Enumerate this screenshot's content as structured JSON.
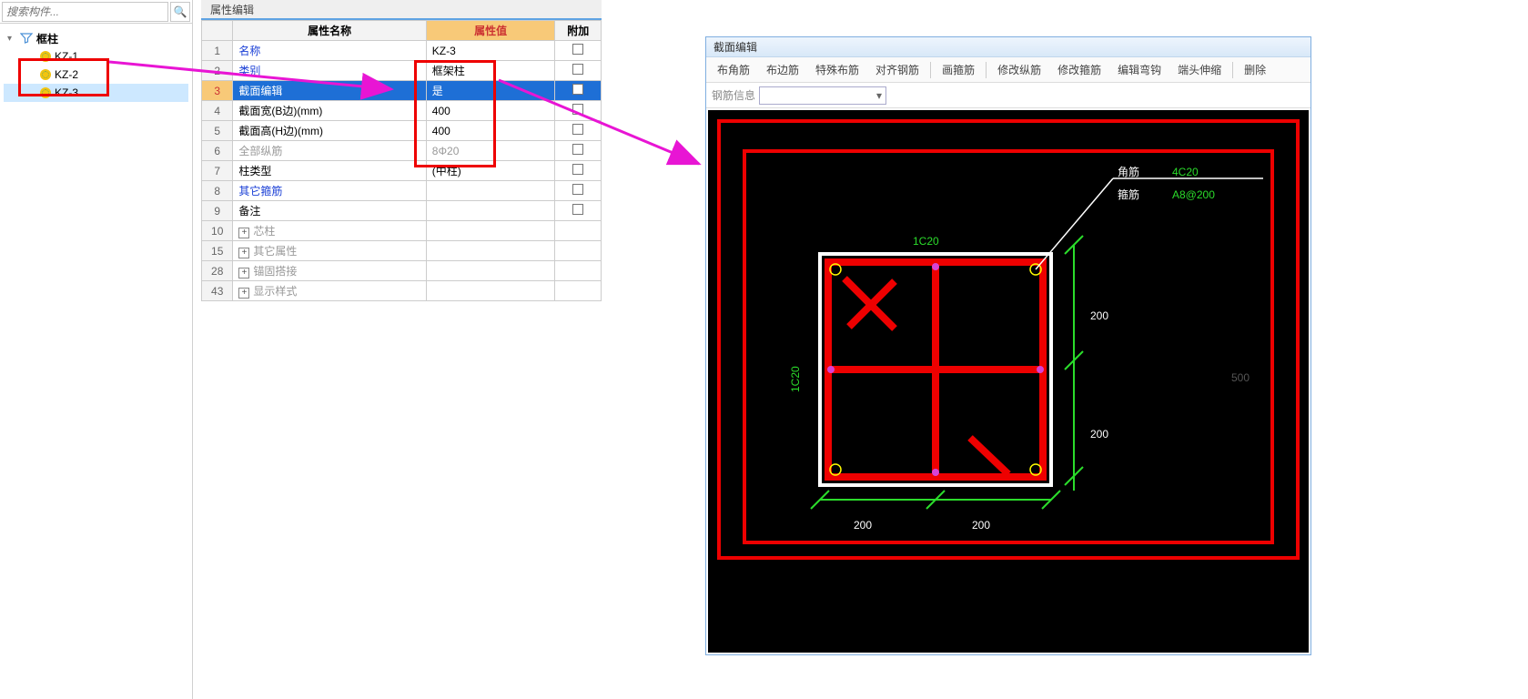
{
  "sidebar": {
    "search_placeholder": "搜索构件...",
    "root_label": "框柱",
    "items": [
      {
        "label": "KZ-1"
      },
      {
        "label": "KZ-2"
      },
      {
        "label": "KZ-3"
      }
    ]
  },
  "prop": {
    "title": "属性编辑",
    "headers": {
      "name": "属性名称",
      "value": "属性值",
      "extra": "附加"
    },
    "rows": [
      {
        "num": "1",
        "name": "名称",
        "value": "KZ-3",
        "link": true,
        "chk": false
      },
      {
        "num": "2",
        "name": "类别",
        "value": "框架柱",
        "link": true,
        "chk": true
      },
      {
        "num": "3",
        "name": "截面编辑",
        "value": "是",
        "sel": true,
        "chk": false
      },
      {
        "num": "4",
        "name": "截面宽(B边)(mm)",
        "value": "400",
        "chk": true
      },
      {
        "num": "5",
        "name": "截面高(H边)(mm)",
        "value": "400",
        "chk": true
      },
      {
        "num": "6",
        "name": "全部纵筋",
        "value": "8Φ20",
        "gray": true,
        "valgray": true,
        "chk": true
      },
      {
        "num": "7",
        "name": "柱类型",
        "value": "(中柱)",
        "chk": true
      },
      {
        "num": "8",
        "name": "其它箍筋",
        "value": "",
        "link": true,
        "chk": false
      },
      {
        "num": "9",
        "name": "备注",
        "value": "",
        "chk": true
      },
      {
        "num": "10",
        "name": "芯柱",
        "exp": true,
        "gray": true
      },
      {
        "num": "15",
        "name": "其它属性",
        "exp": true,
        "gray": true
      },
      {
        "num": "28",
        "name": "锚固搭接",
        "exp": true,
        "gray": true
      },
      {
        "num": "43",
        "name": "显示样式",
        "exp": true,
        "gray": true
      }
    ]
  },
  "section": {
    "title": "截面编辑",
    "tools": [
      "布角筋",
      "布边筋",
      "特殊布筋",
      "对齐钢筋",
      "画箍筋",
      "修改纵筋",
      "修改箍筋",
      "编辑弯钩",
      "端头伸缩",
      "删除"
    ],
    "rebar_label": "钢筋信息",
    "annotations": {
      "corner_label": "角筋",
      "corner_val": "4C20",
      "stirrup_label": "箍筋",
      "stirrup_val": "A8@200",
      "top_label": "1C20",
      "left_label": "1C20",
      "dim_half": "200",
      "dim_faint": "500"
    }
  }
}
